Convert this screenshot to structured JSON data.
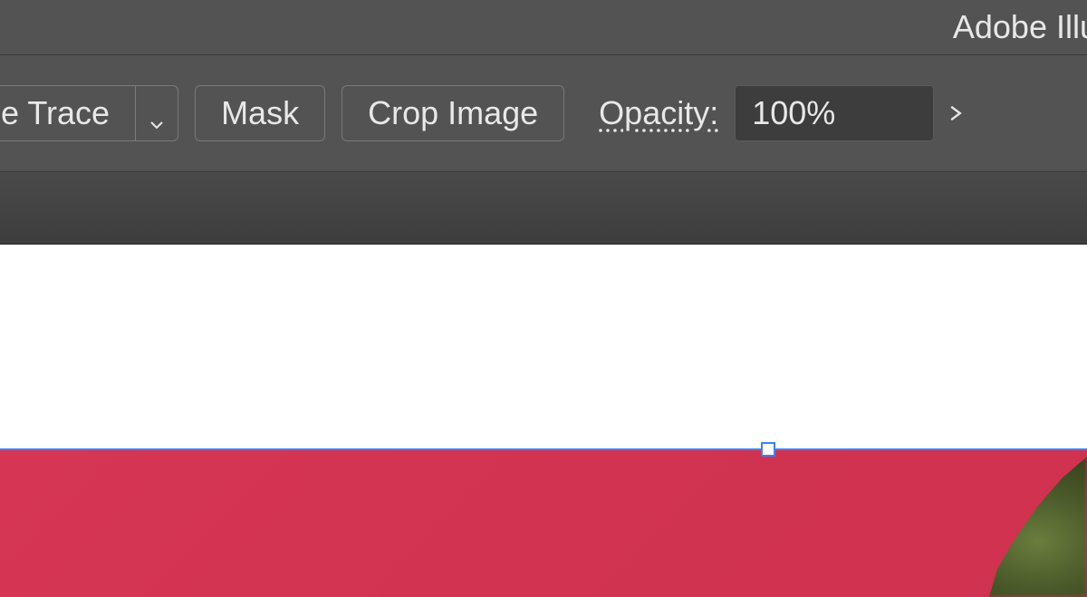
{
  "app": {
    "title": "Adobe Illust"
  },
  "controlbar": {
    "image_trace": "e Trace",
    "mask": "Mask",
    "crop_image": "Crop Image",
    "opacity_label": "Opacity:",
    "opacity_value": "100%"
  },
  "canvas": {
    "selection_color": "#3b82f6",
    "image_bg_color": "#d63654"
  }
}
